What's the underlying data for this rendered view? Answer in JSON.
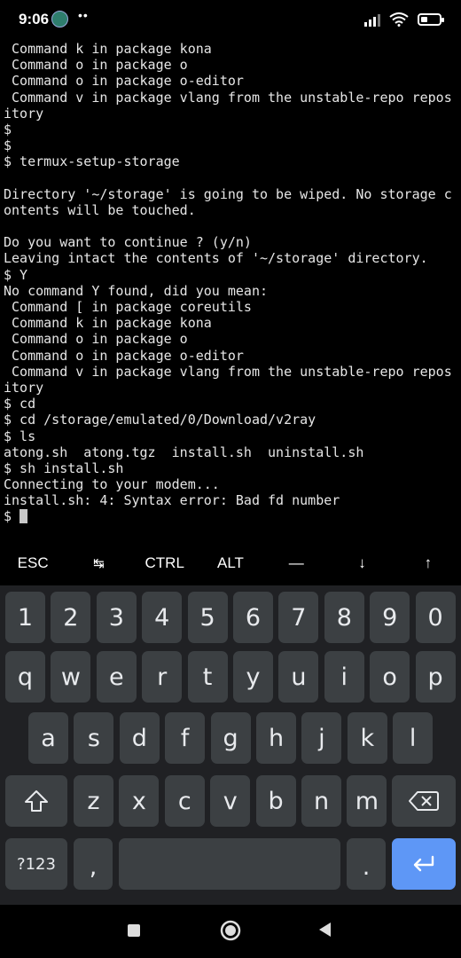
{
  "status_bar": {
    "time": "9:06",
    "dots": "••",
    "battery_percent": 35
  },
  "terminal": {
    "lines": [
      " Command k in package kona",
      " Command o in package o",
      " Command o in package o-editor",
      " Command v in package vlang from the unstable-repo repos",
      "itory",
      "$",
      "$",
      "$ termux-setup-storage",
      "",
      "Directory '~/storage' is going to be wiped. No storage c",
      "ontents will be touched.",
      "",
      "Do you want to continue ? (y/n)",
      "Leaving intact the contents of '~/storage' directory.",
      "$ Y",
      "No command Y found, did you mean:",
      " Command [ in package coreutils",
      " Command k in package kona",
      " Command o in package o",
      " Command o in package o-editor",
      " Command v in package vlang from the unstable-repo repos",
      "itory",
      "$ cd",
      "$ cd /storage/emulated/0/Download/v2ray",
      "$ ls",
      "atong.sh  atong.tgz  install.sh  uninstall.sh",
      "$ sh install.sh",
      "Connecting to your modem...",
      "install.sh: 4: Syntax error: Bad fd number"
    ],
    "prompt": "$ "
  },
  "extra_keys": [
    "ESC",
    "↹",
    "CTRL",
    "ALT",
    "—",
    "↓",
    "↑"
  ],
  "keyboard": {
    "row_numbers": [
      "1",
      "2",
      "3",
      "4",
      "5",
      "6",
      "7",
      "8",
      "9",
      "0"
    ],
    "row_top": [
      "q",
      "w",
      "e",
      "r",
      "t",
      "y",
      "u",
      "i",
      "o",
      "p"
    ],
    "row_home": [
      "a",
      "s",
      "d",
      "f",
      "g",
      "h",
      "j",
      "k",
      "l"
    ],
    "row_bottom": [
      "z",
      "x",
      "c",
      "v",
      "b",
      "n",
      "m"
    ],
    "symbols_label": "?123",
    "comma": ",",
    "period": "."
  },
  "colors": {
    "terminal_bg": "#000000",
    "keyboard_bg": "#202124",
    "key_bg": "#3c4043",
    "action_key": "#5e97f6"
  }
}
